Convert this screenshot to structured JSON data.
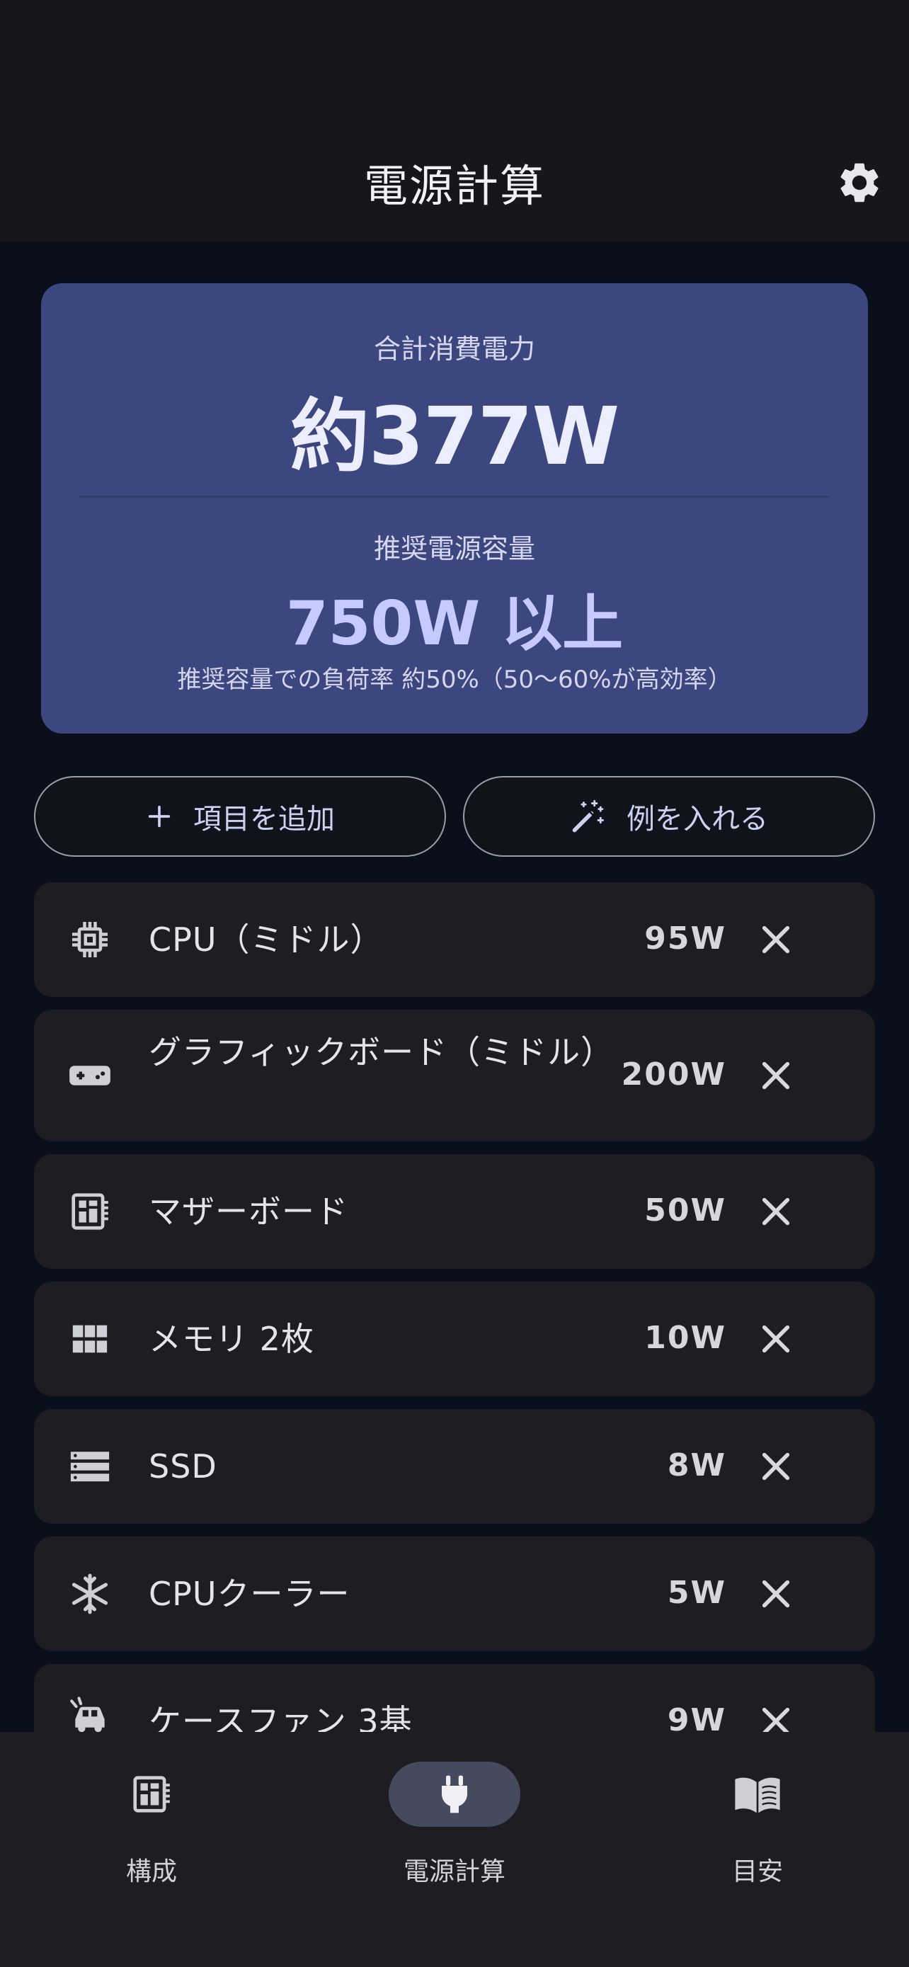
{
  "header": {
    "title": "電源計算",
    "settings_icon": "gear-icon"
  },
  "summary": {
    "total_label": "合計消費電力",
    "total_value": "約377W",
    "recommended_label": "推奨電源容量",
    "recommended_value": "750W 以上",
    "load_note": "推奨容量での負荷率 約50%（50〜60%が高効率）"
  },
  "actions": {
    "add_label": "項目を追加",
    "add_icon": "plus-icon",
    "example_label": "例を入れる",
    "example_icon": "magic-wand-icon"
  },
  "items": [
    {
      "icon": "cpu-chip-icon",
      "name": "CPU（ミドル）",
      "watt": "95W"
    },
    {
      "icon": "gamepad-icon",
      "name": "グラフィックボード（ミドル）",
      "watt": "200W"
    },
    {
      "icon": "motherboard-icon",
      "name": "マザーボード",
      "watt": "50W"
    },
    {
      "icon": "memory-grid-icon",
      "name": "メモリ 2枚",
      "watt": "10W"
    },
    {
      "icon": "storage-icon",
      "name": "SSD",
      "watt": "8W"
    },
    {
      "icon": "snowflake-icon",
      "name": "CPUクーラー",
      "watt": "5W"
    },
    {
      "icon": "fan-icon",
      "name": "ケースファン 3基",
      "watt": "9W"
    }
  ],
  "nav": [
    {
      "label": "構成",
      "icon": "motherboard-icon",
      "active": false
    },
    {
      "label": "電源計算",
      "icon": "plug-icon",
      "active": true
    },
    {
      "label": "目安",
      "icon": "book-icon",
      "active": false
    }
  ],
  "colors": {
    "background": "#0b0f1c",
    "summary_card": "#3c477f",
    "accent": "#c6cbff",
    "item_card": "#1d1d22"
  }
}
